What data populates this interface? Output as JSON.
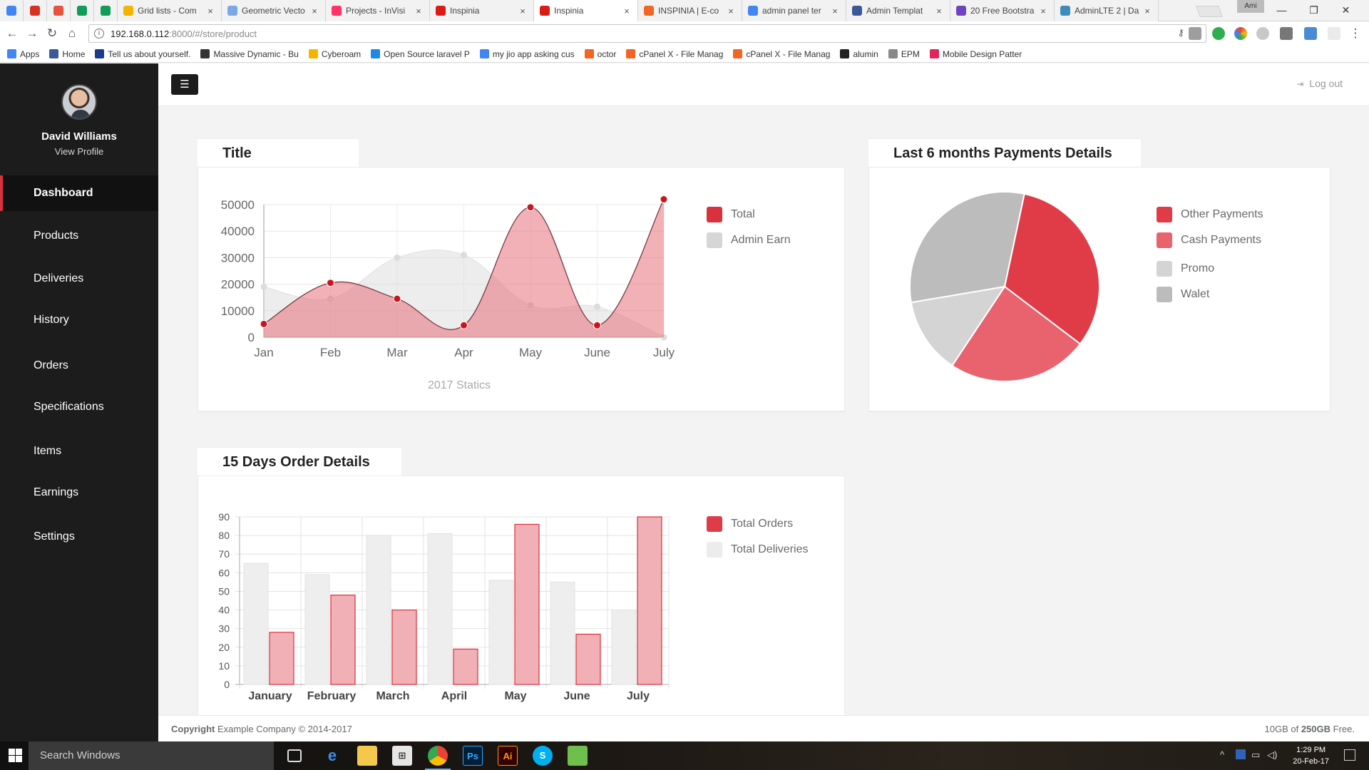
{
  "browser": {
    "tabs": [
      {
        "title": "",
        "active": false,
        "color": "#4285f4"
      },
      {
        "title": "",
        "active": false,
        "color": "#d93025"
      },
      {
        "title": "",
        "active": false,
        "color": "#e8533f"
      },
      {
        "title": "",
        "active": false,
        "color": "#0f9d58"
      },
      {
        "title": "",
        "active": false,
        "color": "#0f9d58"
      },
      {
        "title": "Grid lists - Com",
        "active": false,
        "color": "#f4b400"
      },
      {
        "title": "Geometric Vecto",
        "active": false,
        "color": "#7aa7e6"
      },
      {
        "title": "Projects - InVisi",
        "active": false,
        "color": "#ff3366"
      },
      {
        "title": "Inspinia",
        "active": false,
        "color": "#dd1b16"
      },
      {
        "title": "Inspinia",
        "active": true,
        "color": "#dd1b16"
      },
      {
        "title": "INSPINIA | E-co",
        "active": false,
        "color": "#f26522"
      },
      {
        "title": "admin panel ter",
        "active": false,
        "color": "#4285f4"
      },
      {
        "title": "Admin Templat",
        "active": false,
        "color": "#3b5998"
      },
      {
        "title": "20 Free Bootstra",
        "active": false,
        "color": "#6f42c1"
      },
      {
        "title": "AdminLTE 2 | Da",
        "active": false,
        "color": "#3c8dbc"
      }
    ],
    "account_badge": "Ami",
    "url_host": "192.168.0.112",
    "url_path": ":8000/#/store/product",
    "bookmarks": [
      {
        "label": "Apps",
        "color": "#4285f4"
      },
      {
        "label": "Home",
        "color": "#3b5998"
      },
      {
        "label": "Tell us about yourself.",
        "color": "#1a3c8a"
      },
      {
        "label": "Massive Dynamic - Bu",
        "color": "#333333"
      },
      {
        "label": "Cyberoam",
        "color": "#f4b400"
      },
      {
        "label": "Open Source laravel P",
        "color": "#1e88e5"
      },
      {
        "label": "my jio app asking cus",
        "color": "#4285f4"
      },
      {
        "label": "octor",
        "color": "#f26522"
      },
      {
        "label": "cPanel X - File Manag",
        "color": "#f26522"
      },
      {
        "label": "cPanel X - File Manag",
        "color": "#f26522"
      },
      {
        "label": "alumin",
        "color": "#222222"
      },
      {
        "label": "EPM",
        "color": "#888888"
      },
      {
        "label": "Mobile Design Patter",
        "color": "#e2245b"
      }
    ]
  },
  "user": {
    "name": "David Williams",
    "view_profile": "View Profile"
  },
  "nav": [
    "Dashboard",
    "Products",
    "Deliveries",
    "History",
    "Orders",
    "Specifications",
    "Items",
    "Earnings",
    "Settings"
  ],
  "topbar": {
    "menu_icon": "☰",
    "logout": "Log out"
  },
  "colors": {
    "accent": "#d9313d",
    "sidebar": "#1c1c1c",
    "pink": "#e8a0a7",
    "grey": "#d6d6d6"
  },
  "chart_data": [
    {
      "type": "area",
      "title": "Title",
      "caption": "2017 Statics",
      "categories": [
        "Jan",
        "Feb",
        "Mar",
        "Apr",
        "May",
        "June",
        "July"
      ],
      "ylim": [
        0,
        50000
      ],
      "yticks": [
        0,
        10000,
        20000,
        30000,
        40000,
        50000
      ],
      "series": [
        {
          "name": "Total",
          "values": [
            5000,
            20500,
            14500,
            4500,
            49000,
            4500,
            52000
          ],
          "color": "#d9313d"
        },
        {
          "name": "Admin Earn",
          "values": [
            19000,
            14500,
            30000,
            31000,
            12000,
            11500,
            0
          ],
          "color": "#d6d6d6"
        }
      ],
      "legend_position": "right"
    },
    {
      "type": "pie",
      "title": "Last 6 months Payments Details",
      "series": [
        {
          "name": "Other Payments",
          "value": 32,
          "color": "#e03c48"
        },
        {
          "name": "Cash Payments",
          "value": 24,
          "color": "#e8636d"
        },
        {
          "name": "Promo",
          "value": 13,
          "color": "#d4d4d4"
        },
        {
          "name": "Walet",
          "value": 31,
          "color": "#bcbcbc"
        }
      ],
      "legend_position": "right"
    },
    {
      "type": "bar",
      "title": "15 Days Order Details",
      "categories": [
        "January",
        "February",
        "March",
        "April",
        "May",
        "June",
        "July"
      ],
      "ylim": [
        0,
        90
      ],
      "yticks": [
        0,
        10,
        20,
        30,
        40,
        50,
        60,
        70,
        80,
        90
      ],
      "series": [
        {
          "name": "Total Orders",
          "values": [
            28,
            48,
            40,
            19,
            86,
            27,
            90
          ],
          "color": "#e03c48"
        },
        {
          "name": "Total Deliveries",
          "values": [
            65,
            59,
            80,
            81,
            56,
            55,
            40
          ],
          "color": "#ececec"
        }
      ],
      "legend_position": "right"
    }
  ],
  "footer": {
    "copyright_bold": "Copyright",
    "copyright_rest": "Example Company © 2014-2017",
    "storage_used": "10GB of",
    "storage_total": "250GB",
    "storage_suffix": "Free."
  },
  "taskbar": {
    "search": "Search Windows",
    "time": "1:29 PM",
    "date": "20-Feb-17"
  }
}
